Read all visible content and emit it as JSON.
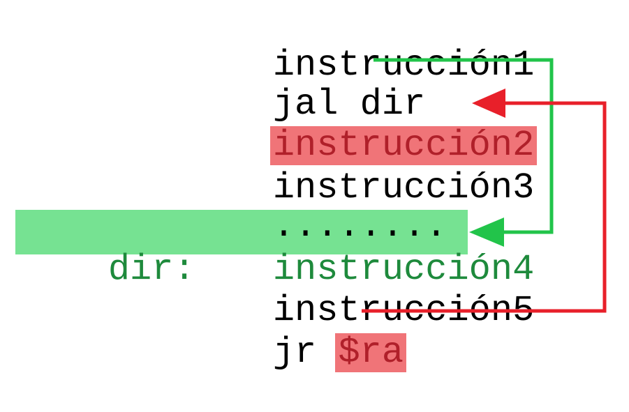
{
  "code_lines": {
    "line1": "instrucción1",
    "line2_op": "jal",
    "line2_arg": "dir",
    "line3": "instrucción2",
    "line4": "instrucción3",
    "line5": "........",
    "line6_label": "dir:",
    "line6": "instrucción4",
    "line7": "instrucción5",
    "line8_op": "jr",
    "line8_arg": "$ra"
  },
  "colors": {
    "call_arrow": "#22c44a",
    "return_arrow": "#e8202a",
    "target_highlight": "#76e292",
    "return_highlight": "#f07478"
  }
}
